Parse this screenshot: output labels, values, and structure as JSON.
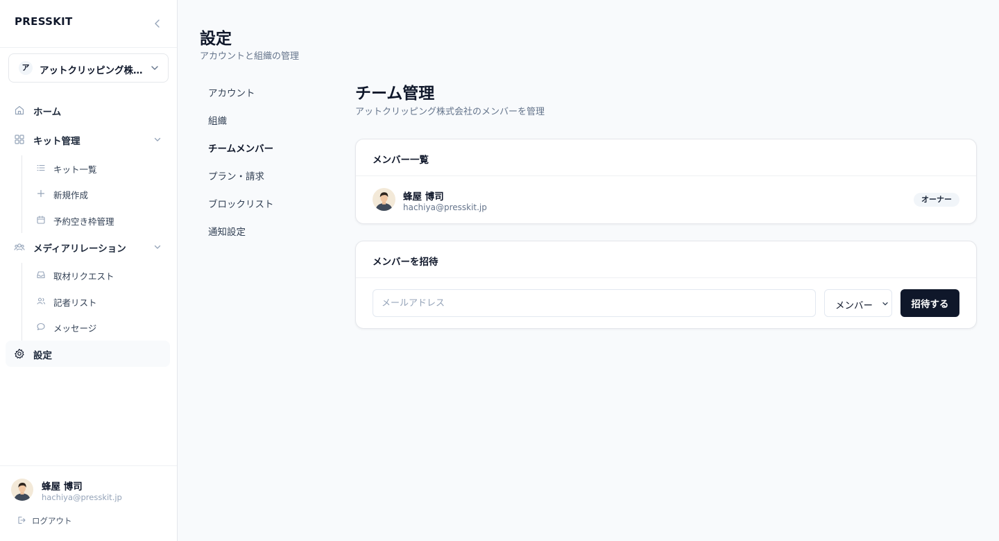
{
  "app": {
    "logo_text": "PRESSKIT"
  },
  "org": {
    "initial": "ア",
    "name": "アットクリッピング株式会社"
  },
  "sidebar": {
    "home": "ホーム",
    "kit_management": "キット管理",
    "kit_list": "キット一覧",
    "new_create": "新規作成",
    "slot_management": "予約空き枠管理",
    "media_relations": "メディアリレーション",
    "interview_requests": "取材リクエスト",
    "journalist_list": "記者リスト",
    "messages": "メッセージ",
    "settings": "設定"
  },
  "user": {
    "name": "蜂屋 博司",
    "email": "hachiya@presskit.jp",
    "logout": "ログアウト"
  },
  "page": {
    "title": "設定",
    "subtitle": "アカウントと組織の管理"
  },
  "settings_nav": {
    "account": "アカウント",
    "organization": "組織",
    "team_members": "チームメンバー",
    "plan_billing": "プラン・請求",
    "blocklist": "ブロックリスト",
    "notifications": "通知設定"
  },
  "section": {
    "title": "チーム管理",
    "subtitle": "アットクリッピング株式会社のメンバーを管理"
  },
  "members_card": {
    "title": "メンバー一覧",
    "members": [
      {
        "name": "蜂屋 博司",
        "email": "hachiya@presskit.jp",
        "role": "オーナー"
      }
    ]
  },
  "invite_card": {
    "title": "メンバーを招待",
    "email_placeholder": "メールアドレス",
    "role_selected": "メンバー",
    "invite_button": "招待する"
  }
}
